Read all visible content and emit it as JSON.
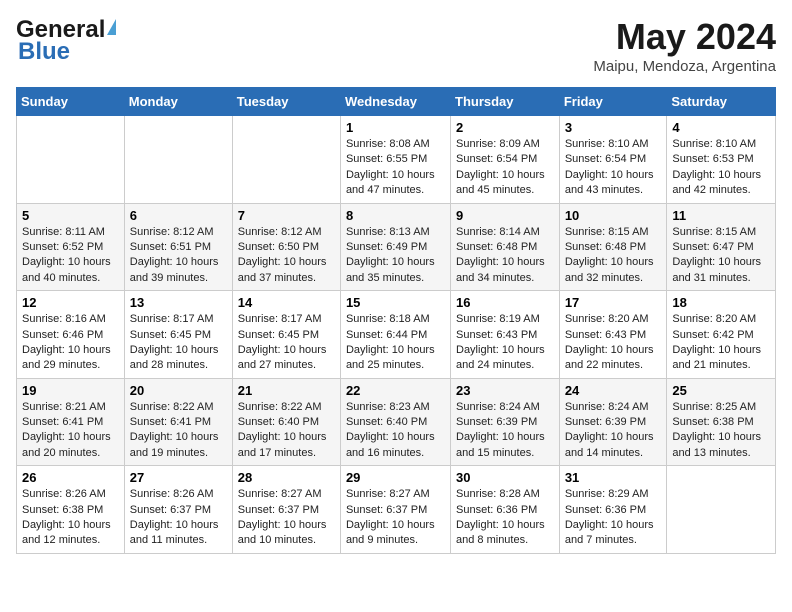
{
  "header": {
    "logo_line1": "General",
    "logo_line2": "Blue",
    "month_year": "May 2024",
    "location": "Maipu, Mendoza, Argentina"
  },
  "days_of_week": [
    "Sunday",
    "Monday",
    "Tuesday",
    "Wednesday",
    "Thursday",
    "Friday",
    "Saturday"
  ],
  "weeks": [
    [
      {
        "num": "",
        "info": ""
      },
      {
        "num": "",
        "info": ""
      },
      {
        "num": "",
        "info": ""
      },
      {
        "num": "1",
        "info": "Sunrise: 8:08 AM\nSunset: 6:55 PM\nDaylight: 10 hours and 47 minutes."
      },
      {
        "num": "2",
        "info": "Sunrise: 8:09 AM\nSunset: 6:54 PM\nDaylight: 10 hours and 45 minutes."
      },
      {
        "num": "3",
        "info": "Sunrise: 8:10 AM\nSunset: 6:54 PM\nDaylight: 10 hours and 43 minutes."
      },
      {
        "num": "4",
        "info": "Sunrise: 8:10 AM\nSunset: 6:53 PM\nDaylight: 10 hours and 42 minutes."
      }
    ],
    [
      {
        "num": "5",
        "info": "Sunrise: 8:11 AM\nSunset: 6:52 PM\nDaylight: 10 hours and 40 minutes."
      },
      {
        "num": "6",
        "info": "Sunrise: 8:12 AM\nSunset: 6:51 PM\nDaylight: 10 hours and 39 minutes."
      },
      {
        "num": "7",
        "info": "Sunrise: 8:12 AM\nSunset: 6:50 PM\nDaylight: 10 hours and 37 minutes."
      },
      {
        "num": "8",
        "info": "Sunrise: 8:13 AM\nSunset: 6:49 PM\nDaylight: 10 hours and 35 minutes."
      },
      {
        "num": "9",
        "info": "Sunrise: 8:14 AM\nSunset: 6:48 PM\nDaylight: 10 hours and 34 minutes."
      },
      {
        "num": "10",
        "info": "Sunrise: 8:15 AM\nSunset: 6:48 PM\nDaylight: 10 hours and 32 minutes."
      },
      {
        "num": "11",
        "info": "Sunrise: 8:15 AM\nSunset: 6:47 PM\nDaylight: 10 hours and 31 minutes."
      }
    ],
    [
      {
        "num": "12",
        "info": "Sunrise: 8:16 AM\nSunset: 6:46 PM\nDaylight: 10 hours and 29 minutes."
      },
      {
        "num": "13",
        "info": "Sunrise: 8:17 AM\nSunset: 6:45 PM\nDaylight: 10 hours and 28 minutes."
      },
      {
        "num": "14",
        "info": "Sunrise: 8:17 AM\nSunset: 6:45 PM\nDaylight: 10 hours and 27 minutes."
      },
      {
        "num": "15",
        "info": "Sunrise: 8:18 AM\nSunset: 6:44 PM\nDaylight: 10 hours and 25 minutes."
      },
      {
        "num": "16",
        "info": "Sunrise: 8:19 AM\nSunset: 6:43 PM\nDaylight: 10 hours and 24 minutes."
      },
      {
        "num": "17",
        "info": "Sunrise: 8:20 AM\nSunset: 6:43 PM\nDaylight: 10 hours and 22 minutes."
      },
      {
        "num": "18",
        "info": "Sunrise: 8:20 AM\nSunset: 6:42 PM\nDaylight: 10 hours and 21 minutes."
      }
    ],
    [
      {
        "num": "19",
        "info": "Sunrise: 8:21 AM\nSunset: 6:41 PM\nDaylight: 10 hours and 20 minutes."
      },
      {
        "num": "20",
        "info": "Sunrise: 8:22 AM\nSunset: 6:41 PM\nDaylight: 10 hours and 19 minutes."
      },
      {
        "num": "21",
        "info": "Sunrise: 8:22 AM\nSunset: 6:40 PM\nDaylight: 10 hours and 17 minutes."
      },
      {
        "num": "22",
        "info": "Sunrise: 8:23 AM\nSunset: 6:40 PM\nDaylight: 10 hours and 16 minutes."
      },
      {
        "num": "23",
        "info": "Sunrise: 8:24 AM\nSunset: 6:39 PM\nDaylight: 10 hours and 15 minutes."
      },
      {
        "num": "24",
        "info": "Sunrise: 8:24 AM\nSunset: 6:39 PM\nDaylight: 10 hours and 14 minutes."
      },
      {
        "num": "25",
        "info": "Sunrise: 8:25 AM\nSunset: 6:38 PM\nDaylight: 10 hours and 13 minutes."
      }
    ],
    [
      {
        "num": "26",
        "info": "Sunrise: 8:26 AM\nSunset: 6:38 PM\nDaylight: 10 hours and 12 minutes."
      },
      {
        "num": "27",
        "info": "Sunrise: 8:26 AM\nSunset: 6:37 PM\nDaylight: 10 hours and 11 minutes."
      },
      {
        "num": "28",
        "info": "Sunrise: 8:27 AM\nSunset: 6:37 PM\nDaylight: 10 hours and 10 minutes."
      },
      {
        "num": "29",
        "info": "Sunrise: 8:27 AM\nSunset: 6:37 PM\nDaylight: 10 hours and 9 minutes."
      },
      {
        "num": "30",
        "info": "Sunrise: 8:28 AM\nSunset: 6:36 PM\nDaylight: 10 hours and 8 minutes."
      },
      {
        "num": "31",
        "info": "Sunrise: 8:29 AM\nSunset: 6:36 PM\nDaylight: 10 hours and 7 minutes."
      },
      {
        "num": "",
        "info": ""
      }
    ]
  ]
}
